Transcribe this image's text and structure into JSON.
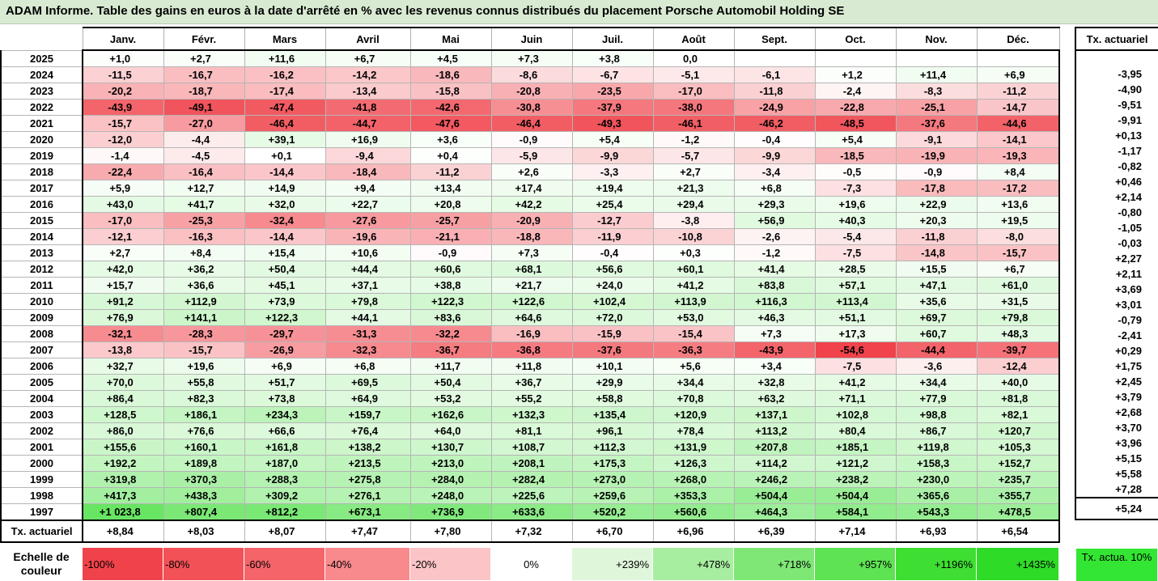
{
  "title": "ADAM Informe. Table des gains en euros à la date d'arrêté en % avec les revenus connus distribués du placement Porsche Automobil Holding SE",
  "months": [
    "Janv.",
    "Févr.",
    "Mars",
    "Avril",
    "Mai",
    "Juin",
    "Juil.",
    "Août",
    "Sept.",
    "Oct.",
    "Nov.",
    "Déc."
  ],
  "side_header": "Tx. actuariel",
  "rows": [
    {
      "year": "2025",
      "vals": [
        "+1,0",
        "+2,7",
        "+11,6",
        "+6,7",
        "+4,5",
        "+7,3",
        "+3,8",
        "0,0",
        "",
        "",
        "",
        ""
      ],
      "tx": ""
    },
    {
      "year": "2024",
      "vals": [
        "-11,5",
        "-16,7",
        "-16,2",
        "-14,2",
        "-18,6",
        "-8,6",
        "-6,7",
        "-5,1",
        "-6,1",
        "+1,2",
        "+11,4",
        "+6,9"
      ],
      "tx": "-3,95"
    },
    {
      "year": "2023",
      "vals": [
        "-20,2",
        "-18,7",
        "-17,4",
        "-13,4",
        "-15,8",
        "-20,8",
        "-23,5",
        "-17,0",
        "-11,8",
        "-2,4",
        "-8,3",
        "-11,2"
      ],
      "tx": "-4,90"
    },
    {
      "year": "2022",
      "vals": [
        "-43,9",
        "-49,1",
        "-47,4",
        "-41,8",
        "-42,6",
        "-30,8",
        "-37,9",
        "-38,0",
        "-24,9",
        "-22,8",
        "-25,1",
        "-14,7"
      ],
      "tx": "-9,51"
    },
    {
      "year": "2021",
      "vals": [
        "-15,7",
        "-27,0",
        "-46,4",
        "-44,7",
        "-47,6",
        "-46,4",
        "-49,3",
        "-46,1",
        "-46,2",
        "-48,5",
        "-37,6",
        "-44,6"
      ],
      "tx": "-9,91"
    },
    {
      "year": "2020",
      "vals": [
        "-12,0",
        "-4,4",
        "+39,1",
        "+16,9",
        "+3,6",
        "-0,9",
        "+5,4",
        "-1,2",
        "-0,4",
        "+5,4",
        "-9,1",
        "-14,1"
      ],
      "tx": "+0,13"
    },
    {
      "year": "2019",
      "vals": [
        "-1,4",
        "-4,5",
        "+0,1",
        "-9,4",
        "+0,4",
        "-5,9",
        "-9,9",
        "-5,7",
        "-9,9",
        "-18,5",
        "-19,9",
        "-19,3"
      ],
      "tx": "-1,17"
    },
    {
      "year": "2018",
      "vals": [
        "-22,4",
        "-16,4",
        "-14,4",
        "-18,4",
        "-11,2",
        "+2,6",
        "-3,3",
        "+2,7",
        "-3,4",
        "-0,5",
        "-0,9",
        "+8,4"
      ],
      "tx": "-0,82"
    },
    {
      "year": "2017",
      "vals": [
        "+5,9",
        "+12,7",
        "+14,9",
        "+9,4",
        "+13,4",
        "+17,4",
        "+19,4",
        "+21,3",
        "+6,8",
        "-7,3",
        "-17,8",
        "-17,2"
      ],
      "tx": "+0,46"
    },
    {
      "year": "2016",
      "vals": [
        "+43,0",
        "+41,7",
        "+32,0",
        "+22,7",
        "+20,8",
        "+42,2",
        "+25,4",
        "+29,4",
        "+29,3",
        "+19,6",
        "+22,9",
        "+13,6"
      ],
      "tx": "+2,14"
    },
    {
      "year": "2015",
      "vals": [
        "-17,0",
        "-25,3",
        "-32,4",
        "-27,6",
        "-25,7",
        "-20,9",
        "-12,7",
        "-3,8",
        "+56,9",
        "+40,3",
        "+20,3",
        "+19,5"
      ],
      "tx": "-0,80"
    },
    {
      "year": "2014",
      "vals": [
        "-12,1",
        "-16,3",
        "-14,4",
        "-19,6",
        "-21,1",
        "-18,8",
        "-11,9",
        "-10,8",
        "-2,6",
        "-5,4",
        "-11,8",
        "-8,0"
      ],
      "tx": "-1,05"
    },
    {
      "year": "2013",
      "vals": [
        "+2,7",
        "+8,4",
        "+15,4",
        "+10,6",
        "-0,9",
        "+7,3",
        "-0,4",
        "+0,3",
        "-1,2",
        "-7,5",
        "-14,8",
        "-15,7"
      ],
      "tx": "-0,03"
    },
    {
      "year": "2012",
      "vals": [
        "+42,0",
        "+36,2",
        "+50,4",
        "+44,4",
        "+60,6",
        "+68,1",
        "+56,6",
        "+60,1",
        "+41,4",
        "+28,5",
        "+15,5",
        "+6,7"
      ],
      "tx": "+2,27"
    },
    {
      "year": "2011",
      "vals": [
        "+15,7",
        "+36,6",
        "+45,1",
        "+37,1",
        "+38,8",
        "+21,7",
        "+24,0",
        "+41,2",
        "+83,8",
        "+57,1",
        "+47,1",
        "+61,0"
      ],
      "tx": "+2,11"
    },
    {
      "year": "2010",
      "vals": [
        "+91,2",
        "+112,9",
        "+73,9",
        "+79,8",
        "+122,3",
        "+122,6",
        "+102,4",
        "+113,9",
        "+116,3",
        "+113,4",
        "+35,6",
        "+31,5"
      ],
      "tx": "+3,69"
    },
    {
      "year": "2009",
      "vals": [
        "+76,9",
        "+141,1",
        "+122,3",
        "+44,1",
        "+83,6",
        "+64,6",
        "+72,0",
        "+53,0",
        "+46,3",
        "+51,1",
        "+69,7",
        "+79,8"
      ],
      "tx": "+3,01"
    },
    {
      "year": "2008",
      "vals": [
        "-32,1",
        "-28,3",
        "-29,7",
        "-31,3",
        "-32,2",
        "-16,9",
        "-15,9",
        "-15,4",
        "+7,3",
        "+17,3",
        "+60,7",
        "+48,3"
      ],
      "tx": "-0,79"
    },
    {
      "year": "2007",
      "vals": [
        "-13,8",
        "-15,7",
        "-26,9",
        "-32,3",
        "-36,7",
        "-36,8",
        "-37,6",
        "-36,3",
        "-43,9",
        "-54,6",
        "-44,4",
        "-39,7"
      ],
      "tx": "-2,41"
    },
    {
      "year": "2006",
      "vals": [
        "+32,7",
        "+19,6",
        "+6,9",
        "+6,8",
        "+11,7",
        "+11,8",
        "+10,1",
        "+5,6",
        "+3,4",
        "-7,5",
        "-3,6",
        "-12,4"
      ],
      "tx": "+0,29"
    },
    {
      "year": "2005",
      "vals": [
        "+70,0",
        "+55,8",
        "+51,7",
        "+69,5",
        "+50,4",
        "+36,7",
        "+29,9",
        "+34,4",
        "+32,8",
        "+41,2",
        "+34,4",
        "+40,0"
      ],
      "tx": "+1,75"
    },
    {
      "year": "2004",
      "vals": [
        "+86,4",
        "+82,3",
        "+73,8",
        "+64,9",
        "+53,2",
        "+55,2",
        "+58,8",
        "+70,8",
        "+63,2",
        "+71,1",
        "+77,9",
        "+81,8"
      ],
      "tx": "+2,45"
    },
    {
      "year": "2003",
      "vals": [
        "+128,5",
        "+186,1",
        "+234,3",
        "+159,7",
        "+162,6",
        "+132,3",
        "+135,4",
        "+120,9",
        "+137,1",
        "+102,8",
        "+98,8",
        "+82,1"
      ],
      "tx": "+3,79"
    },
    {
      "year": "2002",
      "vals": [
        "+86,0",
        "+76,6",
        "+66,6",
        "+76,4",
        "+64,0",
        "+81,1",
        "+96,1",
        "+78,4",
        "+113,2",
        "+80,4",
        "+86,7",
        "+120,7"
      ],
      "tx": "+2,68"
    },
    {
      "year": "2001",
      "vals": [
        "+155,6",
        "+160,1",
        "+161,8",
        "+138,2",
        "+130,7",
        "+108,7",
        "+112,3",
        "+131,9",
        "+207,8",
        "+185,1",
        "+119,8",
        "+105,3"
      ],
      "tx": "+3,70"
    },
    {
      "year": "2000",
      "vals": [
        "+192,2",
        "+189,8",
        "+187,0",
        "+213,5",
        "+213,0",
        "+208,1",
        "+175,3",
        "+126,3",
        "+114,2",
        "+121,2",
        "+158,3",
        "+152,7"
      ],
      "tx": "+3,96"
    },
    {
      "year": "1999",
      "vals": [
        "+319,8",
        "+370,3",
        "+288,3",
        "+275,8",
        "+284,0",
        "+282,4",
        "+273,0",
        "+268,0",
        "+246,2",
        "+238,2",
        "+230,0",
        "+235,7"
      ],
      "tx": "+5,15"
    },
    {
      "year": "1998",
      "vals": [
        "+417,3",
        "+438,3",
        "+309,2",
        "+276,1",
        "+248,0",
        "+225,6",
        "+259,6",
        "+353,3",
        "+504,4",
        "+504,4",
        "+365,6",
        "+355,7"
      ],
      "tx": "+5,58"
    },
    {
      "year": "1997",
      "vals": [
        "+1 023,8",
        "+807,4",
        "+812,2",
        "+673,1",
        "+736,9",
        "+633,6",
        "+520,2",
        "+560,6",
        "+464,3",
        "+584,1",
        "+543,3",
        "+478,5"
      ],
      "tx": "+7,28"
    }
  ],
  "footer": {
    "label": "Tx. actuariel",
    "vals": [
      "+8,84",
      "+8,03",
      "+8,07",
      "+7,47",
      "+7,80",
      "+7,32",
      "+6,70",
      "+6,96",
      "+6,39",
      "+7,14",
      "+6,93",
      "+6,54"
    ],
    "tx": "+5,24"
  },
  "scale": {
    "label": "Echelle de couleur",
    "items": [
      {
        "text": "-100%",
        "color": "#f0424a",
        "kind": "neg"
      },
      {
        "text": "-80%",
        "color": "#f25157",
        "kind": "neg"
      },
      {
        "text": "-60%",
        "color": "#f46469",
        "kind": "neg"
      },
      {
        "text": "-40%",
        "color": "#f8898c",
        "kind": "neg"
      },
      {
        "text": "-20%",
        "color": "#fbc4c6",
        "kind": "neg"
      },
      {
        "text": "0%",
        "color": "#ffffff",
        "kind": "zero"
      },
      {
        "text": "+239%",
        "color": "#e0f6db",
        "kind": "pos"
      },
      {
        "text": "+478%",
        "color": "#a8eea0",
        "kind": "pos"
      },
      {
        "text": "+718%",
        "color": "#7fe775",
        "kind": "pos"
      },
      {
        "text": "+957%",
        "color": "#5ee352",
        "kind": "pos"
      },
      {
        "text": "+1196%",
        "color": "#3edf32",
        "kind": "pos"
      },
      {
        "text": "+1435%",
        "color": "#2edb26",
        "kind": "pos"
      }
    ],
    "actu_label": "Tx. actua. 10%",
    "actu_color": "#33e633"
  },
  "colors": {
    "title_bg": "#d9ead3",
    "negative_max": "#f0424a",
    "positive_max": "#2edb26"
  }
}
